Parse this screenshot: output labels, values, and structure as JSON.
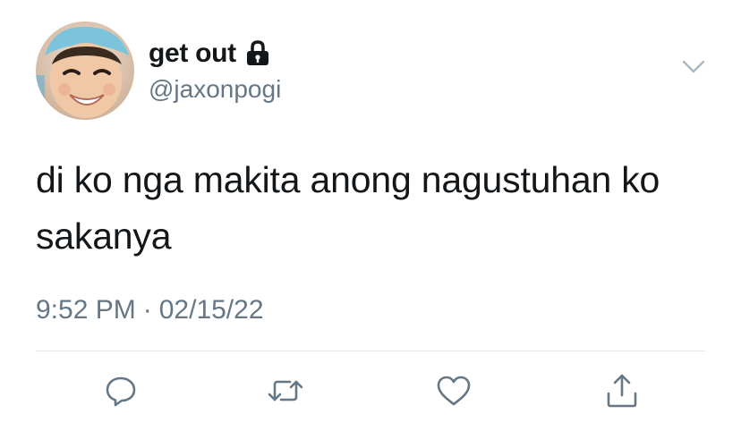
{
  "tweet": {
    "author": {
      "display_name": "get out",
      "handle": "@jaxonpogi",
      "protected_icon": "lock-icon",
      "avatar": "child-photo-avatar"
    },
    "text": "di ko nga makita anong nagustuhan ko sakanya",
    "timestamp": {
      "time": "9:52 PM",
      "separator": "·",
      "date": "02/15/22"
    },
    "menu_icon": "chevron-down-icon",
    "actions": [
      {
        "icon": "reply-icon"
      },
      {
        "icon": "retweet-icon"
      },
      {
        "icon": "like-icon"
      },
      {
        "icon": "share-icon"
      }
    ]
  },
  "colors": {
    "text_primary": "#14171a",
    "text_secondary": "#657786",
    "divider": "#e1e8ed",
    "background": "#ffffff"
  }
}
